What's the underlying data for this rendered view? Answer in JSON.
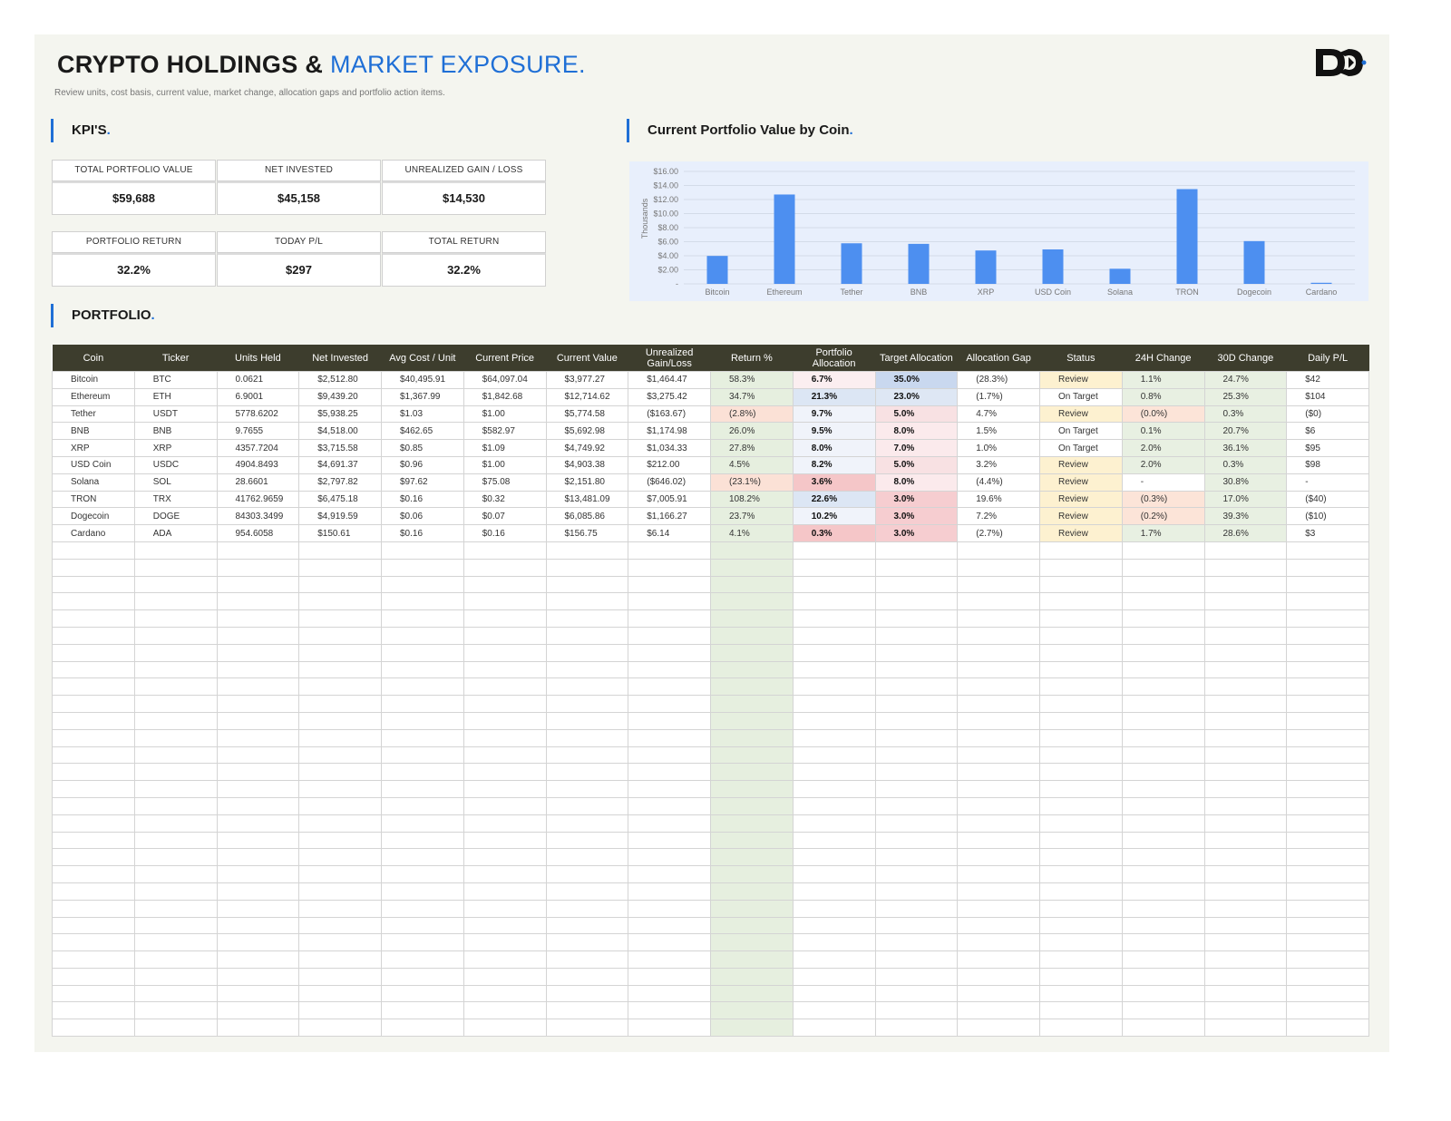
{
  "header": {
    "title_main": "CRYPTO HOLDINGS & ",
    "title_accent": "MARKET EXPOSURE.",
    "subtitle": "Review units, cost basis, current value, market change, allocation gaps and portfolio action items."
  },
  "sections": {
    "kpis": "KPI'S",
    "chart": "Current Portfolio Value by Coin",
    "portfolio": "PORTFOLIO"
  },
  "kpis": [
    {
      "label": "TOTAL PORTFOLIO VALUE",
      "value": "$59,688"
    },
    {
      "label": "NET INVESTED",
      "value": "$45,158"
    },
    {
      "label": "UNREALIZED GAIN / LOSS",
      "value": "$14,530"
    },
    {
      "label": "PORTFOLIO RETURN",
      "value": "32.2%"
    },
    {
      "label": "TODAY P/L",
      "value": "$297"
    },
    {
      "label": "TOTAL RETURN",
      "value": "32.2%"
    }
  ],
  "colors": {
    "accent": "#1f6fd6",
    "header_bg": "#3d3d2d",
    "bar": "#4d8ff0",
    "chart_bg": "#e8effc",
    "negative": "#e05050",
    "return_bg": "#e6efdf",
    "review_bg": "#fdf1d0"
  },
  "chart_data": {
    "type": "bar",
    "title": "Current Portfolio Value by Coin",
    "ylabel": "Thousands",
    "categories": [
      "Bitcoin",
      "Ethereum",
      "Tether",
      "BNB",
      "XRP",
      "USD Coin",
      "Solana",
      "TRON",
      "Dogecoin",
      "Cardano"
    ],
    "values": [
      3.97727,
      12.71462,
      5.77458,
      5.69298,
      4.74992,
      4.90338,
      2.1518,
      13.48109,
      6.08586,
      0.15675
    ],
    "ylim": [
      0,
      16
    ],
    "yticks": [
      0,
      2,
      4,
      6,
      8,
      10,
      12,
      14,
      16
    ],
    "ytick_labels": [
      "-",
      "$2.00",
      "$4.00",
      "$6.00",
      "$8.00",
      "$10.00",
      "$12.00",
      "$14.00",
      "$16.00"
    ],
    "grid": true,
    "legend": "none"
  },
  "table": {
    "columns": [
      "Coin",
      "Ticker",
      "Units Held",
      "Net Invested",
      "Avg Cost / Unit",
      "Current Price",
      "Current Value",
      "Unrealized Gain/Loss",
      "Return %",
      "Portfolio Allocation",
      "Target Allocation",
      "Allocation Gap",
      "Status",
      "24H Change",
      "30D Change",
      "Daily P/L"
    ],
    "rows": [
      [
        "Bitcoin",
        "BTC",
        "0.0621",
        "$2,512.80",
        "$40,495.91",
        "$64,097.04",
        "$3,977.27",
        "$1,464.47",
        "58.3%",
        "6.7%",
        "35.0%",
        "(28.3%)",
        "Review",
        "1.1%",
        "24.7%",
        "$42"
      ],
      [
        "Ethereum",
        "ETH",
        "6.9001",
        "$9,439.20",
        "$1,367.99",
        "$1,842.68",
        "$12,714.62",
        "$3,275.42",
        "34.7%",
        "21.3%",
        "23.0%",
        "(1.7%)",
        "On Target",
        "0.8%",
        "25.3%",
        "$104"
      ],
      [
        "Tether",
        "USDT",
        "5778.6202",
        "$5,938.25",
        "$1.03",
        "$1.00",
        "$5,774.58",
        "($163.67)",
        "(2.8%)",
        "9.7%",
        "5.0%",
        "4.7%",
        "Review",
        "(0.0%)",
        "0.3%",
        "($0)"
      ],
      [
        "BNB",
        "BNB",
        "9.7655",
        "$4,518.00",
        "$462.65",
        "$582.97",
        "$5,692.98",
        "$1,174.98",
        "26.0%",
        "9.5%",
        "8.0%",
        "1.5%",
        "On Target",
        "0.1%",
        "20.7%",
        "$6"
      ],
      [
        "XRP",
        "XRP",
        "4357.7204",
        "$3,715.58",
        "$0.85",
        "$1.09",
        "$4,749.92",
        "$1,034.33",
        "27.8%",
        "8.0%",
        "7.0%",
        "1.0%",
        "On Target",
        "2.0%",
        "36.1%",
        "$95"
      ],
      [
        "USD Coin",
        "USDC",
        "4904.8493",
        "$4,691.37",
        "$0.96",
        "$1.00",
        "$4,903.38",
        "$212.00",
        "4.5%",
        "8.2%",
        "5.0%",
        "3.2%",
        "Review",
        "2.0%",
        "0.3%",
        "$98"
      ],
      [
        "Solana",
        "SOL",
        "28.6601",
        "$2,797.82",
        "$97.62",
        "$75.08",
        "$2,151.80",
        "($646.02)",
        "(23.1%)",
        "3.6%",
        "8.0%",
        "(4.4%)",
        "Review",
        "-",
        "30.8%",
        "-"
      ],
      [
        "TRON",
        "TRX",
        "41762.9659",
        "$6,475.18",
        "$0.16",
        "$0.32",
        "$13,481.09",
        "$7,005.91",
        "108.2%",
        "22.6%",
        "3.0%",
        "19.6%",
        "Review",
        "(0.3%)",
        "17.0%",
        "($40)"
      ],
      [
        "Dogecoin",
        "DOGE",
        "84303.3499",
        "$4,919.59",
        "$0.06",
        "$0.07",
        "$6,085.86",
        "$1,166.27",
        "23.7%",
        "10.2%",
        "3.0%",
        "7.2%",
        "Review",
        "(0.2%)",
        "39.3%",
        "($10)"
      ],
      [
        "Cardano",
        "ADA",
        "954.6058",
        "$150.61",
        "$0.16",
        "$0.16",
        "$156.75",
        "$6.14",
        "4.1%",
        "0.3%",
        "3.0%",
        "(2.7%)",
        "Review",
        "1.7%",
        "28.6%",
        "$3"
      ]
    ]
  }
}
